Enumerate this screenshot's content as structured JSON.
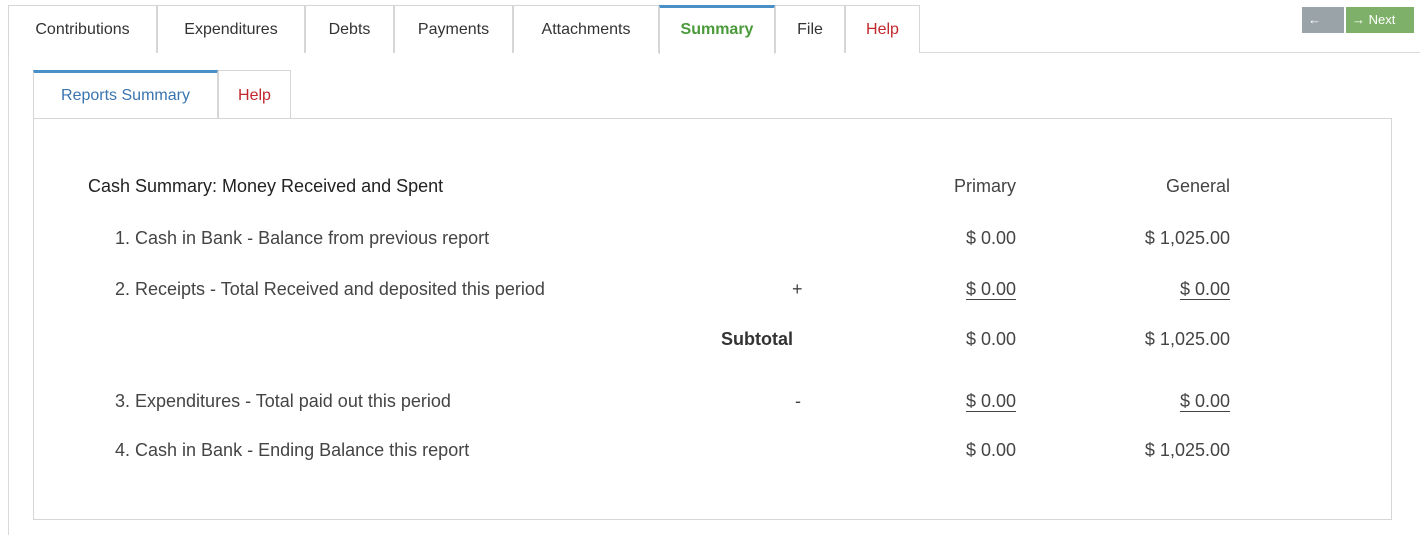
{
  "top_tabs": [
    {
      "label": "Contributions"
    },
    {
      "label": "Expenditures"
    },
    {
      "label": "Debts"
    },
    {
      "label": "Payments"
    },
    {
      "label": "Attachments"
    },
    {
      "label": "Summary"
    },
    {
      "label": "File"
    },
    {
      "label": "Help"
    }
  ],
  "nav": {
    "prev_label": "← Prev",
    "next_label": "→ Next"
  },
  "inner_tabs": [
    {
      "label": "Reports Summary"
    },
    {
      "label": "Help"
    }
  ],
  "summary": {
    "heading": "Cash Summary: Money Received and Spent",
    "col_primary": "Primary",
    "col_general": "General",
    "rows": [
      {
        "label": "1. Cash in Bank - Balance from previous report",
        "op": "",
        "primary": "$ 0.00",
        "general": "$ 1,025.00"
      },
      {
        "label": "2. Receipts - Total Received and deposited this period",
        "op": "+",
        "primary": "$ 0.00",
        "general": "$ 0.00"
      },
      {
        "label": "",
        "op": "Subtotal",
        "primary": "$ 0.00",
        "general": "$ 1,025.00"
      },
      {
        "label": "3. Expenditures - Total paid out this period",
        "op": "-",
        "primary": "$ 0.00",
        "general": "$ 0.00"
      },
      {
        "label": "4. Cash in Bank - Ending Balance this report",
        "op": "",
        "primary": "$ 0.00",
        "general": "$ 1,025.00"
      }
    ]
  },
  "colors": {
    "active_tab_accent": "#4a90c8",
    "summary_tab_text": "#4a9a3a",
    "help_text": "#c0282c",
    "next_button": "#7fb069",
    "prev_button": "#9aa3a8"
  }
}
